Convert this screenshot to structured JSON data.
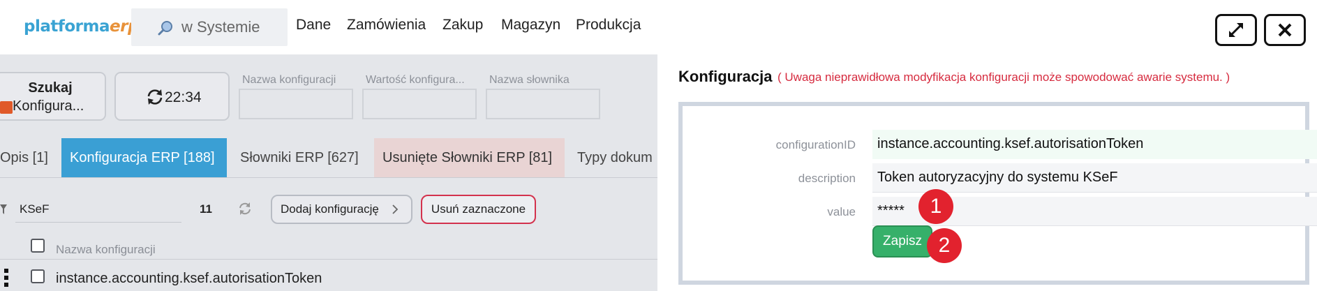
{
  "header": {
    "logo_primary": "platforma",
    "logo_accent": "erp",
    "search_text": "w Systemie",
    "menu": [
      "Dane",
      "Zamówienia",
      "Zakup",
      "Magazyn",
      "Produkcja"
    ]
  },
  "toolbar": {
    "search_button_line1": "Szukaj",
    "search_button_line2": "Konfigura...",
    "refresh_time": "22:34",
    "filters": [
      "Nazwa konfiguracji",
      "Wartość konfigura...",
      "Nazwa słownika"
    ]
  },
  "tabs": [
    "Opis [1]",
    "Konfiguracja ERP [188]",
    "Słowniki ERP [627]",
    "Usunięte Słowniki ERP [81]",
    "Typy dokum"
  ],
  "list": {
    "filter_value": "KSeF",
    "count": "11",
    "add_button": "Dodaj konfigurację",
    "delete_button": "Usuń zaznaczone",
    "column_header": "Nazwa konfiguracji",
    "rows": [
      "instance.accounting.ksef.autorisationToken"
    ]
  },
  "panel": {
    "title": "Konfiguracja",
    "warning": "( Uwaga nieprawidłowa modyfikacja konfiguracji może spowodować awarie systemu. )",
    "fields": [
      {
        "label": "configurationID",
        "value": "instance.accounting.ksef.autorisationToken"
      },
      {
        "label": "description",
        "value": "Token autoryzacyjny do systemu KSeF"
      },
      {
        "label": "value",
        "value": "*****"
      }
    ],
    "save_button": "Zapisz",
    "markers": [
      "1",
      "2"
    ]
  },
  "colors": {
    "accent_blue": "#3a9fd4",
    "save_green": "#36b06a",
    "danger_red": "#d62b3f",
    "marker_red": "#e2222e",
    "logo_orange": "#e8923a"
  },
  "icons": [
    "search-icon",
    "refresh-icon",
    "filter-icon",
    "chevron-right-icon",
    "expand-icon",
    "close-icon",
    "kebab-icon",
    "resize-grip-icon"
  ]
}
